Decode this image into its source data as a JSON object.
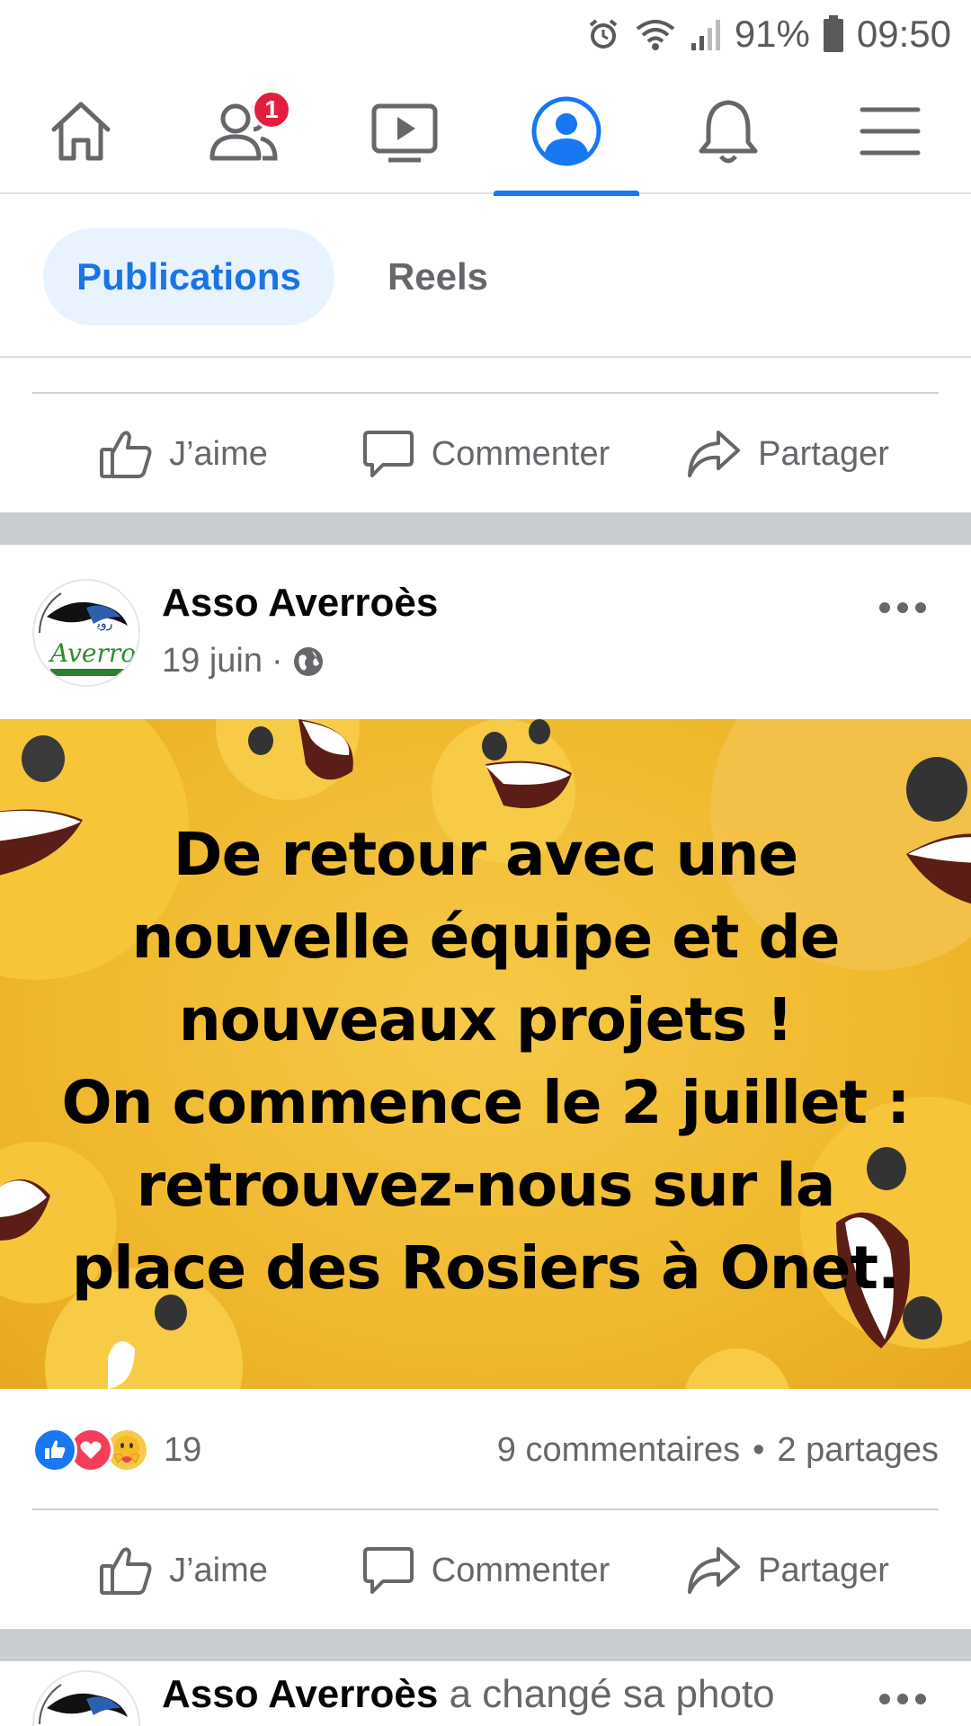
{
  "status_bar": {
    "battery": "91%",
    "time": "09:50",
    "icons": [
      "alarm-icon",
      "wifi-icon",
      "signal-icon",
      "battery-icon"
    ]
  },
  "top_nav": {
    "tabs": [
      {
        "name": "home",
        "icon": "home-icon",
        "active": false
      },
      {
        "name": "friends",
        "icon": "friends-icon",
        "active": false,
        "badge": "1"
      },
      {
        "name": "watch",
        "icon": "video-icon",
        "active": false
      },
      {
        "name": "profile",
        "icon": "profile-icon",
        "active": true
      },
      {
        "name": "notifications",
        "icon": "bell-icon",
        "active": false
      },
      {
        "name": "menu",
        "icon": "hamburger-icon",
        "active": false
      }
    ],
    "friends_badge": "1"
  },
  "filters": {
    "publications": "Publications",
    "reels": "Reels"
  },
  "actions": {
    "like": "J’aime",
    "comment": "Commenter",
    "share": "Partager"
  },
  "post": {
    "author": "Asso Averroès",
    "date": "19 juin",
    "dot": "·",
    "image_text_lines": [
      "De retour avec une",
      "nouvelle équipe et de",
      "nouveaux projets !",
      "On commence le 2 juillet :",
      "retrouvez-nous sur la",
      "place des Rosiers à Onet."
    ],
    "reactions_count": "19",
    "comments": "9 commentaires",
    "separator": "•",
    "shares": "2 partages"
  },
  "next_post": {
    "author": "Asso Averroès",
    "action": "a changé sa photo"
  },
  "colors": {
    "accent": "#1877f2",
    "badge": "#e41e3f",
    "image_bg": "#f0b92e",
    "muted_text": "#65676b"
  }
}
